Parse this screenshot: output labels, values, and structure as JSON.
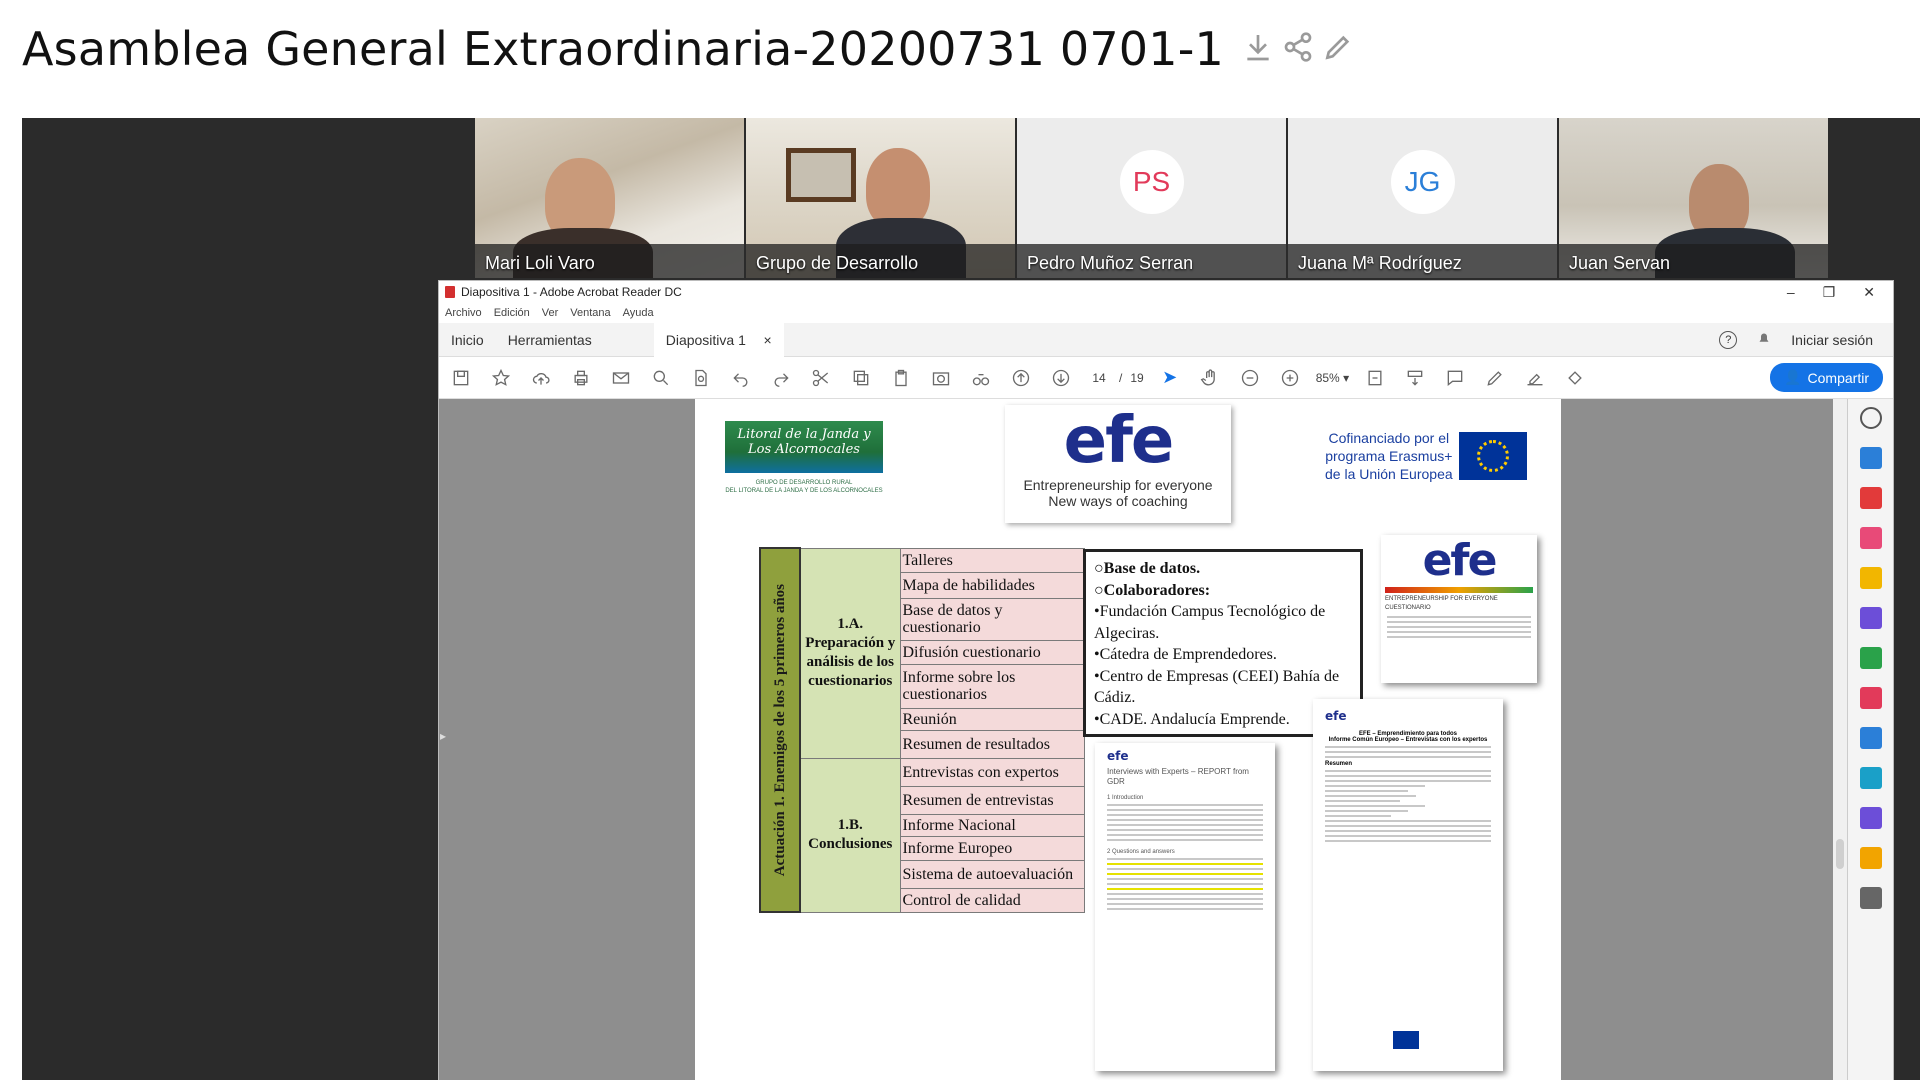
{
  "page": {
    "title": "Asamblea General Extraordinaria-20200731 0701-1"
  },
  "participants": [
    {
      "name": "Mari Loli Varo"
    },
    {
      "name": "Grupo de Desarrollo"
    },
    {
      "name": "Pedro Muñoz Serran",
      "initials": "PS",
      "color": "#e23a5a"
    },
    {
      "name": "Juana Mª Rodríguez",
      "initials": "JG",
      "color": "#2b7fd8"
    },
    {
      "name": "Juan Servan"
    }
  ],
  "acrobat": {
    "window_title": "Diapositiva 1 - Adobe Acrobat Reader DC",
    "menu": [
      "Archivo",
      "Edición",
      "Ver",
      "Ventana",
      "Ayuda"
    ],
    "tabs": {
      "home": "Inicio",
      "tools": "Herramientas",
      "doc": "Diapositiva 1",
      "close": "×"
    },
    "signin": "Iniciar sesión",
    "page_current": "14",
    "page_separator": "/",
    "page_total": "19",
    "zoom": "85%",
    "share": "Compartir",
    "accent": "#1473e6"
  },
  "slide": {
    "logo_litoral": {
      "line1": "Litoral de la Janda y",
      "line2": "Los Alcornocales",
      "sub1": "GRUPO DE DESARROLLO RURAL",
      "sub2": "DEL LITORAL DE LA JANDA Y DE LOS ALCORNOCALES"
    },
    "logo_efe": {
      "word": "efe",
      "sub1": "Entrepreneurship for everyone",
      "sub2": "New ways of coaching"
    },
    "cofinanciado": {
      "line1": "Cofinanciado por el",
      "line2": "programa Erasmus+",
      "line3": "de la Unión Europea"
    },
    "table": {
      "vertical": "Actuación 1. Enemigos de los 5 primeros años",
      "groups": [
        {
          "label": "1.A. Preparación y análisis de los cuestionarios",
          "items": [
            "Talleres",
            "Mapa de habilidades",
            "Base de datos y cuestionario",
            "Difusión cuestionario",
            "Informe sobre los cuestionarios",
            "Reunión",
            "Resumen de resultados"
          ]
        },
        {
          "label": "1.B. Conclusiones",
          "items": [
            "Entrevistas con expertos",
            "Resumen de entrevistas",
            "Informe Nacional",
            "Informe Europeo",
            "Sistema de autoevaluación",
            "Control de calidad"
          ]
        }
      ]
    },
    "bullets": {
      "b1": "Base de datos.",
      "b2": "Colaboradores:",
      "b3": "Fundación Campus Tecnológico de Algeciras.",
      "b4": "Cátedra de Emprendedores.",
      "b5": "Centro de Empresas (CEEI) Bahía de Cádiz.",
      "b6": "CADE. Andalucía Emprende."
    },
    "thumb1": {
      "header": "ENTREPRENEURSHIP FOR EVERYONE",
      "sub": "CUESTIONARIO"
    },
    "thumb2": {
      "title": "Interviews with Experts – REPORT from GDR",
      "s1": "1 Introduction",
      "s2": "2 Questions and answers"
    },
    "thumb3": {
      "title": "EFE – Emprendimiento para todos",
      "sub": "Informe Común Europeo – Entrevistas con los expertos",
      "sec": "Resumen"
    }
  }
}
